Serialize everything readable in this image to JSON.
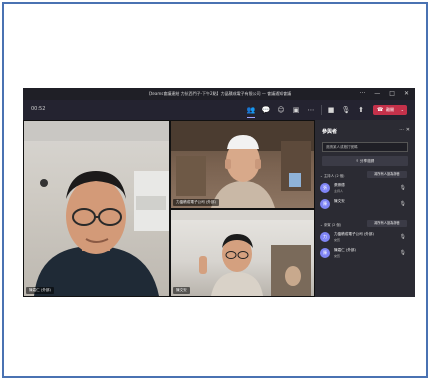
{
  "window": {
    "title": "【teams會議連結 力抗西門子-下午2點】力晶積成電子有限公司 — 會議通知會議",
    "controls": {
      "more": "···",
      "minimize": "—",
      "maximize": "□",
      "close": "✕"
    }
  },
  "toolbar": {
    "timer": "00:52",
    "icons": [
      "people-icon",
      "chat-icon",
      "reactions-icon",
      "rooms-icon",
      "more-icon",
      "camera-icon",
      "mic-icon",
      "share-icon"
    ],
    "leave_label": "離開"
  },
  "tiles": [
    {
      "name": "陳嘉仁 (外部)"
    },
    {
      "name": "力晶積成電子公司 (外部)"
    },
    {
      "name": "陳文安"
    }
  ],
  "participants": {
    "title": "參與者",
    "controls": "⋯  ✕",
    "invite_placeholder": "邀請某人或撥打號碼",
    "share_invite_label": "分享邀請",
    "sections": [
      {
        "label": "⌄ 主持人 (2 個)",
        "mute_all": "將所有人設為靜音",
        "items": [
          {
            "name": "張崇德",
            "role": "主持人",
            "initials": "張"
          },
          {
            "name": "陳文安",
            "role": "",
            "initials": "陳"
          }
        ]
      },
      {
        "label": "⌄ 來賓 (2 個)",
        "mute_all": "將所有人設為靜音",
        "items": [
          {
            "name": "力晶積成電子公司 (外部)",
            "role": "來賓",
            "initials": "力"
          },
          {
            "name": "陳嘉仁 (外部)",
            "role": "來賓",
            "initials": "陳"
          }
        ]
      }
    ]
  },
  "colors": {
    "accent": "#7f85f5",
    "leave": "#c4314b",
    "frame": "#4a72b2"
  }
}
